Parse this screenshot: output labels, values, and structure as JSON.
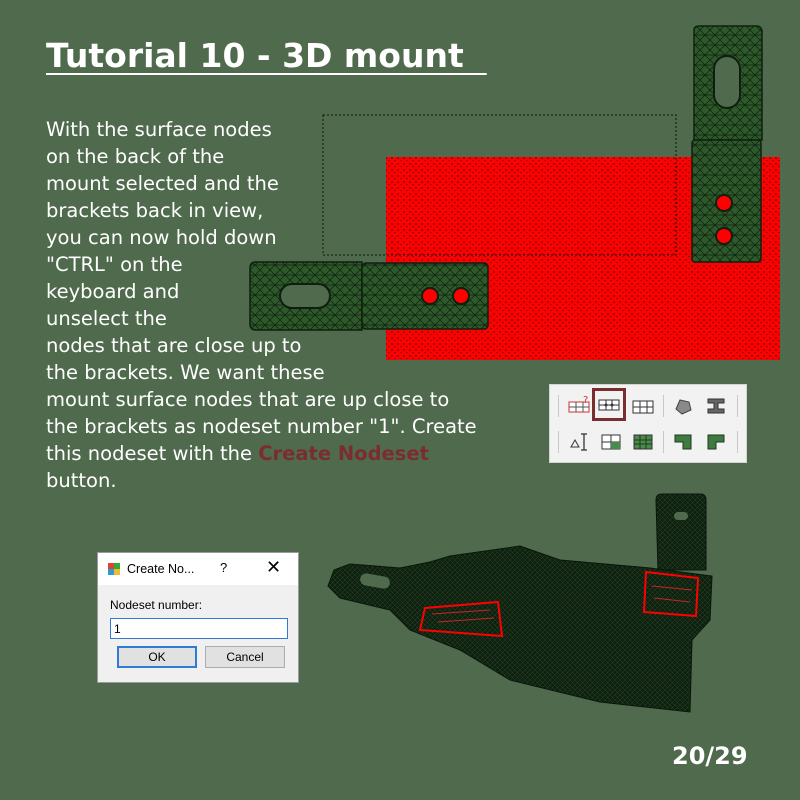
{
  "title": "Tutorial 10 - 3D mount  ",
  "body_lines": [
    "With the surface nodes",
    "on the back of the",
    "mount selected and the",
    "brackets back in view,",
    "you can now hold down",
    "\"CTRL\" on the",
    "keyboard and",
    "unselect the",
    "nodes that are close up to",
    "the brackets. We want these",
    "mount surface nodes that are up close to",
    "the brackets as nodeset number \"1\". Create"
  ],
  "body_line13_prefix": "this nodeset with the ",
  "body_line13_highlight": "Create Nodeset",
  "body_line14": "button.",
  "page_number": "20/29",
  "toolbar": {
    "row1": [
      "add-node-icon",
      "create-nodeset-icon",
      "grid-icon",
      "solid-icon",
      "beam-icon"
    ],
    "row2": [
      "dimension-icon",
      "mesh-select-icon",
      "mesh-grid-icon",
      "bracket-left-icon",
      "bracket-right-icon"
    ]
  },
  "dialog": {
    "title": "Create No...",
    "help": "?",
    "close": "✕",
    "label": "Nodeset number:",
    "value": "1",
    "ok": "OK",
    "cancel": "Cancel"
  },
  "colors": {
    "background": "#4f6a4c",
    "selected": "#ff0000",
    "mesh": "#1f3a1f",
    "highlight": "#7a2d2f"
  }
}
